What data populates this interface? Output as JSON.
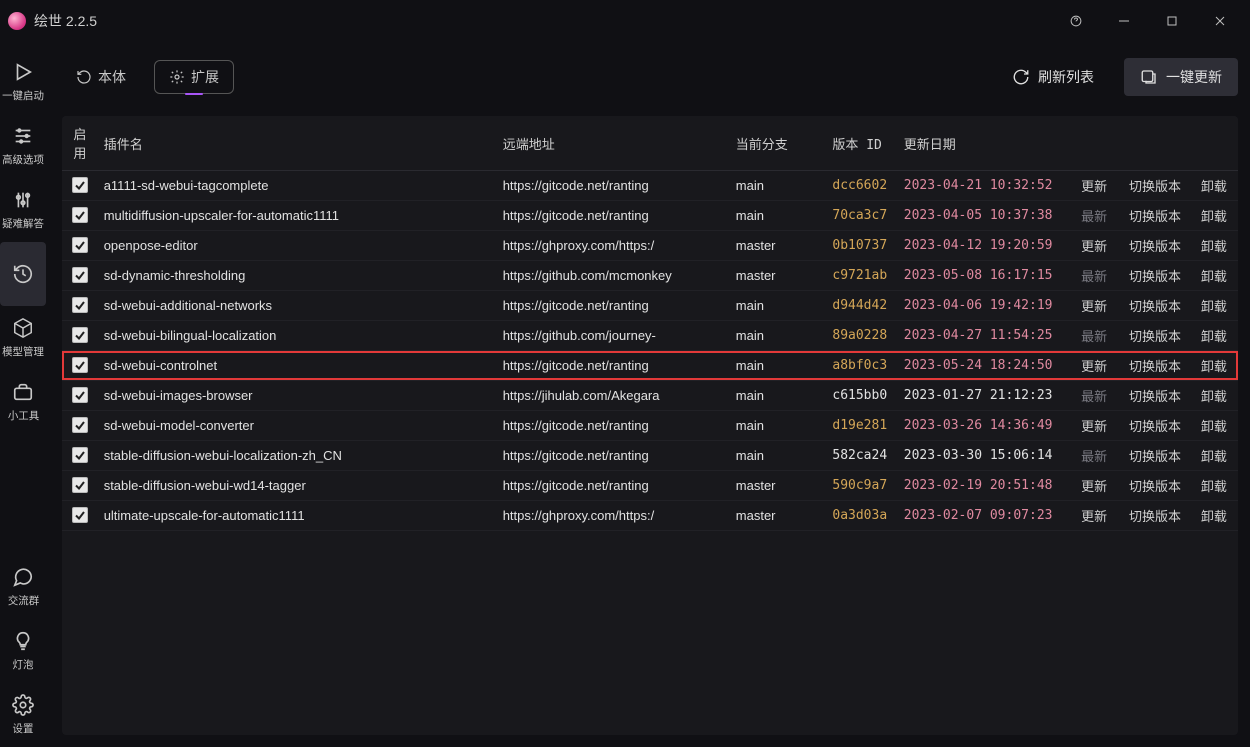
{
  "titlebar": {
    "app_name": "绘世 2.2.5"
  },
  "sidebar": {
    "items": [
      {
        "label": "一键启动",
        "icon": "play"
      },
      {
        "label": "高级选项",
        "icon": "sliders"
      },
      {
        "label": "疑难解答",
        "icon": "tune"
      },
      {
        "label": "",
        "icon": "history",
        "active": true
      },
      {
        "label": "模型管理",
        "icon": "cube"
      },
      {
        "label": "小工具",
        "icon": "briefcase"
      }
    ],
    "bottom": [
      {
        "label": "交流群",
        "icon": "chat"
      },
      {
        "label": "灯泡",
        "icon": "bulb"
      },
      {
        "label": "设置",
        "icon": "gear"
      }
    ]
  },
  "tabs": {
    "tab1": "本体",
    "tab2": "扩展",
    "refresh": "刷新列表",
    "update_all": "一键更新"
  },
  "table": {
    "headers": {
      "enable": "启用",
      "name": "插件名",
      "remote": "远端地址",
      "branch": "当前分支",
      "version": "版本 ID",
      "date": "更新日期"
    },
    "action_update": "更新",
    "action_latest": "最新",
    "action_switch": "切换版本",
    "action_uninstall": "卸载",
    "rows": [
      {
        "enabled": true,
        "name": "a1111-sd-webui-tagcomplete",
        "remote": "https://gitcode.net/ranting",
        "branch": "main",
        "version": "dcc6602",
        "ver_color": "orange",
        "date": "2023-04-21 10:32:52",
        "date_color": "pink",
        "latest": false
      },
      {
        "enabled": true,
        "name": "multidiffusion-upscaler-for-automatic1111",
        "remote": "https://gitcode.net/ranting",
        "branch": "main",
        "version": "70ca3c7",
        "ver_color": "orange",
        "date": "2023-04-05 10:37:38",
        "date_color": "pink",
        "latest": true
      },
      {
        "enabled": true,
        "name": "openpose-editor",
        "remote": "https://ghproxy.com/https:/",
        "branch": "master",
        "version": "0b10737",
        "ver_color": "orange",
        "date": "2023-04-12 19:20:59",
        "date_color": "pink",
        "latest": false
      },
      {
        "enabled": true,
        "name": "sd-dynamic-thresholding",
        "remote": "https://github.com/mcmonkey",
        "branch": "master",
        "version": "c9721ab",
        "ver_color": "orange",
        "date": "2023-05-08 16:17:15",
        "date_color": "pink",
        "latest": true
      },
      {
        "enabled": true,
        "name": "sd-webui-additional-networks",
        "remote": "https://gitcode.net/ranting",
        "branch": "main",
        "version": "d944d42",
        "ver_color": "orange",
        "date": "2023-04-06 19:42:19",
        "date_color": "pink",
        "latest": false
      },
      {
        "enabled": true,
        "name": "sd-webui-bilingual-localization",
        "remote": "https://github.com/journey-",
        "branch": "main",
        "version": "89a0228",
        "ver_color": "orange",
        "date": "2023-04-27 11:54:25",
        "date_color": "pink",
        "latest": true
      },
      {
        "enabled": true,
        "name": "sd-webui-controlnet",
        "remote": "https://gitcode.net/ranting",
        "branch": "main",
        "version": "a8bf0c3",
        "ver_color": "orange",
        "date": "2023-05-24 18:24:50",
        "date_color": "pink",
        "latest": false,
        "highlighted": true
      },
      {
        "enabled": true,
        "name": "sd-webui-images-browser",
        "remote": "https://jihulab.com/Akegara",
        "branch": "main",
        "version": "c615bb0",
        "ver_color": "white",
        "date": "2023-01-27 21:12:23",
        "date_color": "white",
        "latest": true
      },
      {
        "enabled": true,
        "name": "sd-webui-model-converter",
        "remote": "https://gitcode.net/ranting",
        "branch": "main",
        "version": "d19e281",
        "ver_color": "orange",
        "date": "2023-03-26 14:36:49",
        "date_color": "pink",
        "latest": false
      },
      {
        "enabled": true,
        "name": "stable-diffusion-webui-localization-zh_CN",
        "remote": "https://gitcode.net/ranting",
        "branch": "main",
        "version": "582ca24",
        "ver_color": "white",
        "date": "2023-03-30 15:06:14",
        "date_color": "white",
        "latest": true
      },
      {
        "enabled": true,
        "name": "stable-diffusion-webui-wd14-tagger",
        "remote": "https://gitcode.net/ranting",
        "branch": "master",
        "version": "590c9a7",
        "ver_color": "orange",
        "date": "2023-02-19 20:51:48",
        "date_color": "pink",
        "latest": false
      },
      {
        "enabled": true,
        "name": "ultimate-upscale-for-automatic1111",
        "remote": "https://ghproxy.com/https:/",
        "branch": "master",
        "version": "0a3d03a",
        "ver_color": "orange",
        "date": "2023-02-07 09:07:23",
        "date_color": "pink",
        "latest": false
      }
    ]
  }
}
